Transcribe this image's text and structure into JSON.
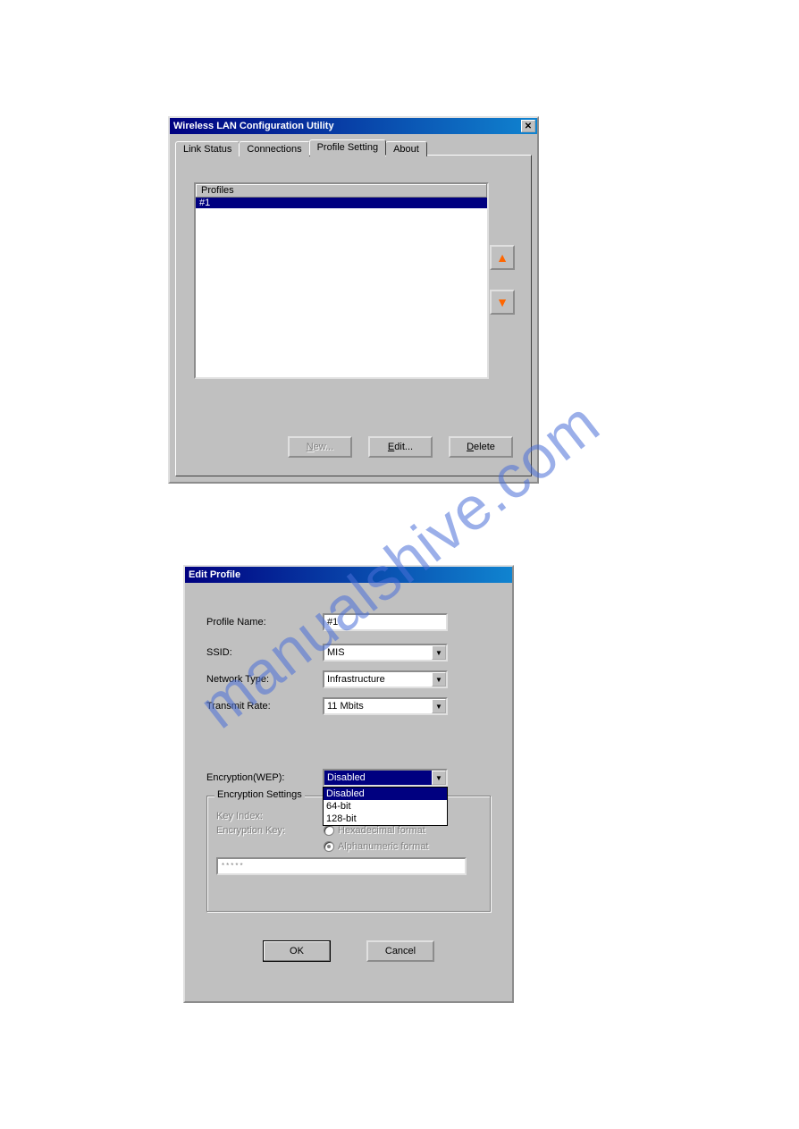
{
  "watermark": "manualshive.com",
  "win1": {
    "title": "Wireless LAN Configuration Utility",
    "tabs": {
      "link_status": "Link Status",
      "connections": "Connections",
      "profile_setting": "Profile Setting",
      "about": "About"
    },
    "profiles_header": "Profiles",
    "profiles": [
      "#1"
    ],
    "buttons": {
      "new_pre": "N",
      "new_post": "ew...",
      "edit_pre": "E",
      "edit_post": "dit...",
      "delete_pre": "D",
      "delete_post": "elete"
    }
  },
  "win2": {
    "title": "Edit Profile",
    "labels": {
      "profile_name": "Profile Name:",
      "ssid": "SSID:",
      "network_type": "Network Type:",
      "transmit_rate": "Transmit Rate:",
      "encryption": "Encryption(WEP):",
      "enc_settings": "Encryption Settings",
      "key_index": "Key Index:",
      "encryption_key": "Encryption Key:",
      "hex_format": "Hexadecimal format",
      "alpha_format": "Alphanumeric format"
    },
    "values": {
      "profile_name": "#1",
      "ssid": "MIS",
      "network_type": "Infrastructure",
      "transmit_rate": "11 Mbits",
      "encryption": "Disabled",
      "key_field": "*****"
    },
    "wep_options": [
      "Disabled",
      "64-bit",
      "128-bit"
    ],
    "buttons": {
      "ok": "OK",
      "cancel": "Cancel"
    }
  }
}
